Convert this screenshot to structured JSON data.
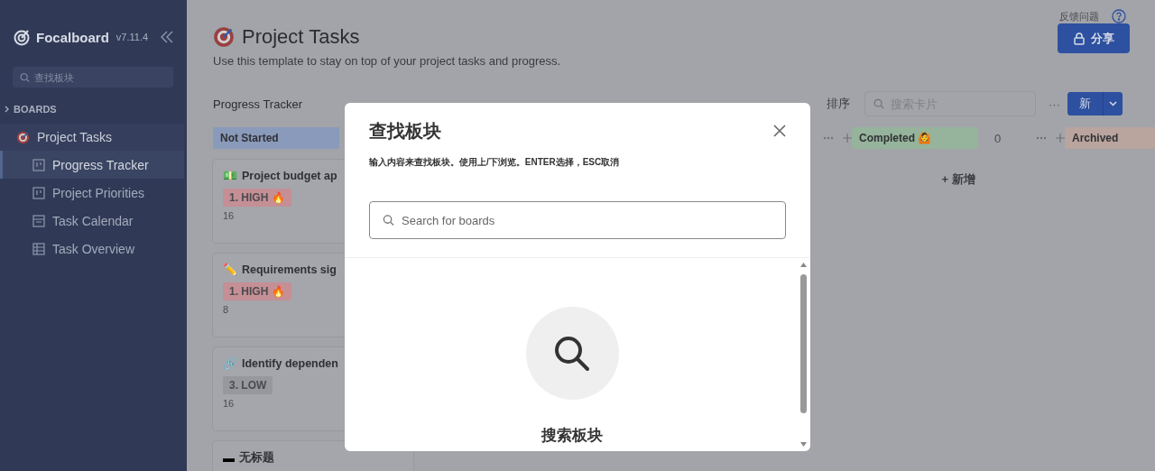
{
  "sidebar": {
    "app_name": "Focalboard",
    "version": "v7.11.4",
    "search": {
      "placeholder": "查找板块"
    },
    "section": "BOARDS",
    "boards": [
      {
        "title": "Project Tasks",
        "children": [
          {
            "title": "Progress Tracker",
            "kind": "board",
            "selected": true
          },
          {
            "title": "Project Priorities",
            "kind": "board",
            "selected": false
          },
          {
            "title": "Task Calendar",
            "kind": "calendar",
            "selected": false
          },
          {
            "title": "Task Overview",
            "kind": "table",
            "selected": false
          }
        ]
      }
    ]
  },
  "header": {
    "feedback": "反馈问题",
    "share_button": "分享",
    "title": "Project Tasks",
    "description": "Use this template to stay on top of your project tasks and progress."
  },
  "view_bar": {
    "view_name": "Progress Tracker",
    "actions": [
      "排序"
    ],
    "search": {
      "placeholder": "搜索卡片"
    },
    "more": "···",
    "new_button": "新"
  },
  "columns": [
    {
      "kind": "group",
      "title": "Not Started",
      "color": "#8a9aba",
      "cards": [
        {
          "icon": "💵",
          "title": "Project budget ap",
          "tag": {
            "label": "1. HIGH 🔥",
            "color": "#c48f95"
          },
          "value": "16"
        },
        {
          "icon": "✏️",
          "title": "Requirements sig",
          "tag": {
            "label": "1. HIGH 🔥",
            "color": "#c48f95"
          },
          "value": "8"
        },
        {
          "icon": "🔗",
          "title": "Identify dependen",
          "tag": {
            "label": "3. LOW",
            "color": "#96989d"
          },
          "value": "16"
        },
        {
          "icon": "▬",
          "title": "无标题"
        }
      ]
    },
    {
      "kind": "covered"
    },
    {
      "kind": "covered",
      "actions": true
    },
    {
      "kind": "group",
      "title": "Completed 🙆",
      "color": "#95b49b",
      "count": "0",
      "actions": true,
      "add_label": "+ 新增"
    },
    {
      "kind": "group",
      "title": "Archived",
      "color": "#b9a49e"
    }
  ],
  "dialog": {
    "title": "查找板块",
    "hint": "输入内容来查找板块。使用上/下浏览。ENTER选择，ESC取消",
    "search": {
      "placeholder": "Search for boards"
    },
    "empty_label": "搜索板块"
  }
}
